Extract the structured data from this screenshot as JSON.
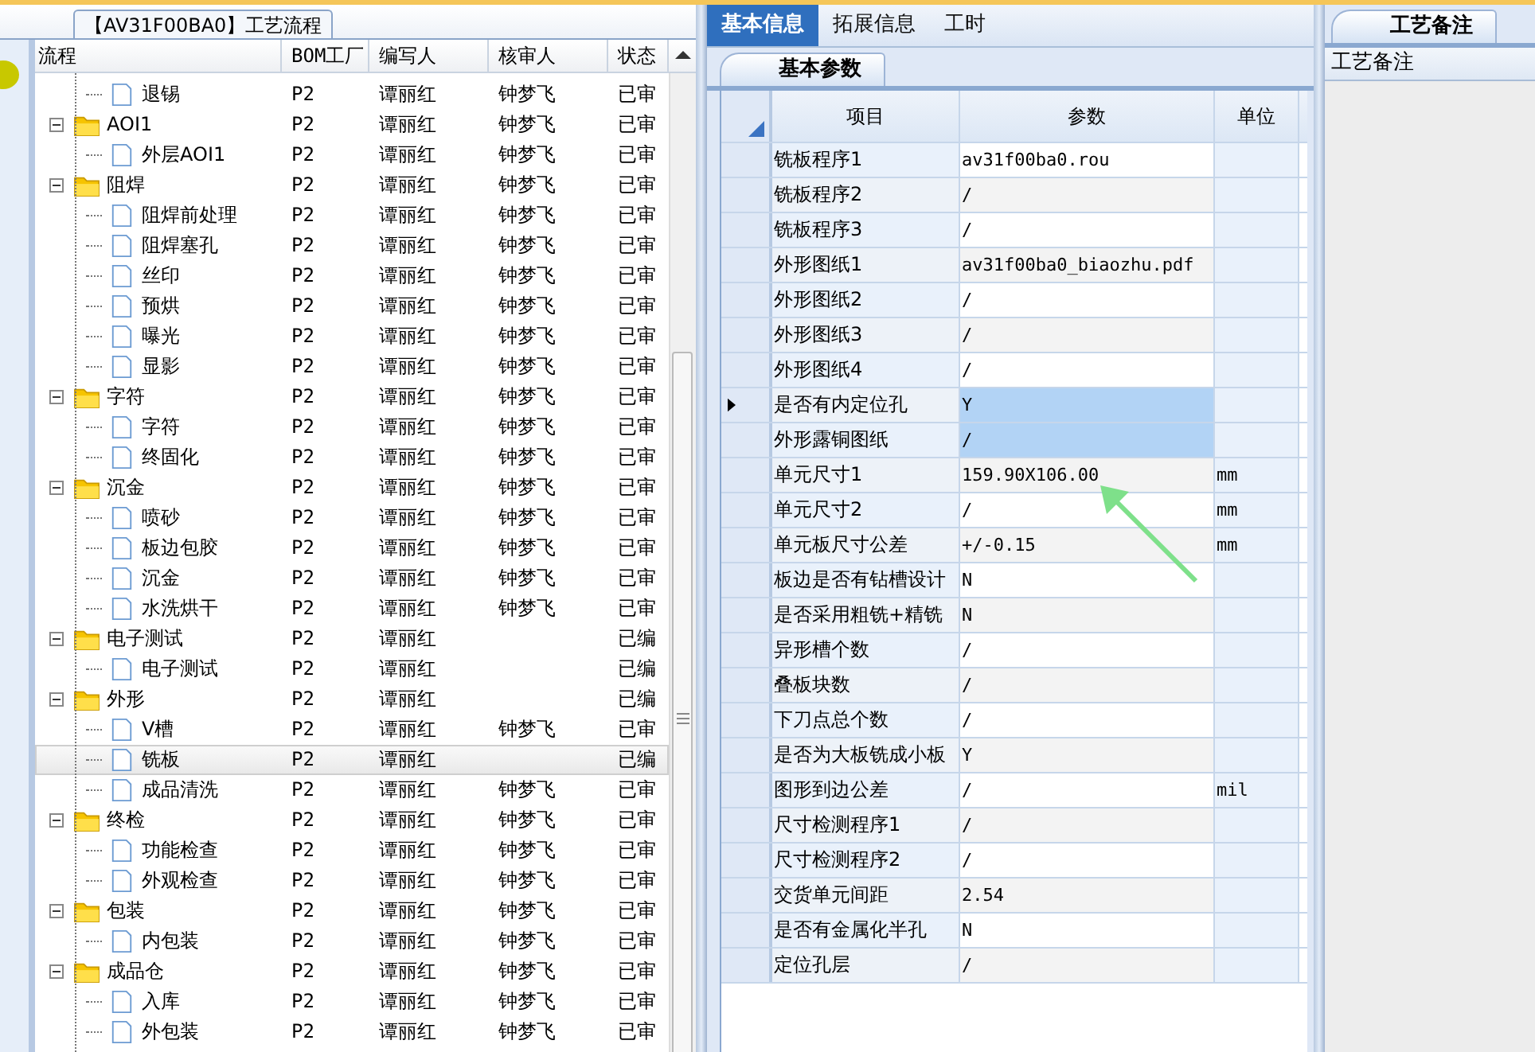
{
  "left_panel": {
    "tab": "【AV31F00BA0】工艺流程",
    "columns": [
      "流程",
      "BOM工厂",
      "编写人",
      "核审人",
      "状态"
    ],
    "tree": [
      {
        "kind": "hidden_folder",
        "children": [
          {
            "kind": "file",
            "label": "退锡",
            "bom_factory": "P2",
            "writer": "谭丽红",
            "reviewer": "钟梦飞",
            "status": "已审",
            "selected": false
          }
        ]
      },
      {
        "kind": "folder",
        "label": "AOI1",
        "bom_factory": "P2",
        "writer": "谭丽红",
        "reviewer": "钟梦飞",
        "status": "已审",
        "selected": false,
        "expanded": true,
        "children": [
          {
            "kind": "file",
            "label": "外层AOI1",
            "bom_factory": "P2",
            "writer": "谭丽红",
            "reviewer": "钟梦飞",
            "status": "已审",
            "selected": false
          }
        ]
      },
      {
        "kind": "folder",
        "label": "阻焊",
        "bom_factory": "P2",
        "writer": "谭丽红",
        "reviewer": "钟梦飞",
        "status": "已审",
        "selected": false,
        "expanded": true,
        "children": [
          {
            "kind": "file",
            "label": "阻焊前处理",
            "bom_factory": "P2",
            "writer": "谭丽红",
            "reviewer": "钟梦飞",
            "status": "已审",
            "selected": false
          },
          {
            "kind": "file",
            "label": "阻焊塞孔",
            "bom_factory": "P2",
            "writer": "谭丽红",
            "reviewer": "钟梦飞",
            "status": "已审",
            "selected": false
          },
          {
            "kind": "file",
            "label": "丝印",
            "bom_factory": "P2",
            "writer": "谭丽红",
            "reviewer": "钟梦飞",
            "status": "已审",
            "selected": false
          },
          {
            "kind": "file",
            "label": "预烘",
            "bom_factory": "P2",
            "writer": "谭丽红",
            "reviewer": "钟梦飞",
            "status": "已审",
            "selected": false
          },
          {
            "kind": "file",
            "label": "曝光",
            "bom_factory": "P2",
            "writer": "谭丽红",
            "reviewer": "钟梦飞",
            "status": "已审",
            "selected": false
          },
          {
            "kind": "file",
            "label": "显影",
            "bom_factory": "P2",
            "writer": "谭丽红",
            "reviewer": "钟梦飞",
            "status": "已审",
            "selected": false
          }
        ]
      },
      {
        "kind": "folder",
        "label": "字符",
        "bom_factory": "P2",
        "writer": "谭丽红",
        "reviewer": "钟梦飞",
        "status": "已审",
        "selected": false,
        "expanded": true,
        "children": [
          {
            "kind": "file",
            "label": "字符",
            "bom_factory": "P2",
            "writer": "谭丽红",
            "reviewer": "钟梦飞",
            "status": "已审",
            "selected": false
          },
          {
            "kind": "file",
            "label": "终固化",
            "bom_factory": "P2",
            "writer": "谭丽红",
            "reviewer": "钟梦飞",
            "status": "已审",
            "selected": false
          }
        ]
      },
      {
        "kind": "folder",
        "label": "沉金",
        "bom_factory": "P2",
        "writer": "谭丽红",
        "reviewer": "钟梦飞",
        "status": "已审",
        "selected": false,
        "expanded": true,
        "children": [
          {
            "kind": "file",
            "label": "喷砂",
            "bom_factory": "P2",
            "writer": "谭丽红",
            "reviewer": "钟梦飞",
            "status": "已审",
            "selected": false
          },
          {
            "kind": "file",
            "label": "板边包胶",
            "bom_factory": "P2",
            "writer": "谭丽红",
            "reviewer": "钟梦飞",
            "status": "已审",
            "selected": false
          },
          {
            "kind": "file",
            "label": "沉金",
            "bom_factory": "P2",
            "writer": "谭丽红",
            "reviewer": "钟梦飞",
            "status": "已审",
            "selected": false
          },
          {
            "kind": "file",
            "label": "水洗烘干",
            "bom_factory": "P2",
            "writer": "谭丽红",
            "reviewer": "钟梦飞",
            "status": "已审",
            "selected": false
          }
        ]
      },
      {
        "kind": "folder",
        "label": "电子测试",
        "bom_factory": "P2",
        "writer": "谭丽红",
        "status": "已编",
        "selected": false,
        "expanded": true,
        "children": [
          {
            "kind": "file",
            "label": "电子测试",
            "bom_factory": "P2",
            "writer": "谭丽红",
            "status": "已编",
            "selected": false
          }
        ]
      },
      {
        "kind": "folder",
        "label": "外形",
        "bom_factory": "P2",
        "writer": "谭丽红",
        "status": "已编",
        "selected": false,
        "expanded": true,
        "children": [
          {
            "kind": "file",
            "label": "V槽",
            "bom_factory": "P2",
            "writer": "谭丽红",
            "reviewer": "钟梦飞",
            "status": "已审",
            "selected": false
          },
          {
            "kind": "file",
            "label": "铣板",
            "bom_factory": "P2",
            "writer": "谭丽红",
            "status": "已编",
            "selected": true
          },
          {
            "kind": "file",
            "label": "成品清洗",
            "bom_factory": "P2",
            "writer": "谭丽红",
            "reviewer": "钟梦飞",
            "status": "已审",
            "selected": false
          }
        ]
      },
      {
        "kind": "folder",
        "label": "终检",
        "bom_factory": "P2",
        "writer": "谭丽红",
        "reviewer": "钟梦飞",
        "status": "已审",
        "selected": false,
        "expanded": true,
        "children": [
          {
            "kind": "file",
            "label": "功能检查",
            "bom_factory": "P2",
            "writer": "谭丽红",
            "reviewer": "钟梦飞",
            "status": "已审",
            "selected": false
          },
          {
            "kind": "file",
            "label": "外观检查",
            "bom_factory": "P2",
            "writer": "谭丽红",
            "reviewer": "钟梦飞",
            "status": "已审",
            "selected": false
          }
        ]
      },
      {
        "kind": "folder",
        "label": "包装",
        "bom_factory": "P2",
        "writer": "谭丽红",
        "reviewer": "钟梦飞",
        "status": "已审",
        "selected": false,
        "expanded": true,
        "children": [
          {
            "kind": "file",
            "label": "内包装",
            "bom_factory": "P2",
            "writer": "谭丽红",
            "reviewer": "钟梦飞",
            "status": "已审",
            "selected": false
          }
        ]
      },
      {
        "kind": "folder",
        "label": "成品仓",
        "bom_factory": "P2",
        "writer": "谭丽红",
        "reviewer": "钟梦飞",
        "status": "已审",
        "selected": false,
        "expanded": true,
        "children": [
          {
            "kind": "file",
            "label": "入库",
            "bom_factory": "P2",
            "writer": "谭丽红",
            "reviewer": "钟梦飞",
            "status": "已审",
            "selected": false
          },
          {
            "kind": "file",
            "label": "外包装",
            "bom_factory": "P2",
            "writer": "谭丽红",
            "reviewer": "钟梦飞",
            "status": "已审",
            "selected": false
          }
        ]
      }
    ]
  },
  "main_tabs": [
    {
      "label": "基本信息",
      "selected": true
    },
    {
      "label": "拓展信息",
      "selected": false
    },
    {
      "label": "工时",
      "selected": false
    }
  ],
  "params_panel": {
    "tab": "基本参数",
    "columns": [
      "项目",
      "参数",
      "单位"
    ],
    "rows": [
      {
        "item": "铣板程序1",
        "value": "av31f00ba0.rou",
        "current": false,
        "selected": false
      },
      {
        "item": "铣板程序2",
        "value": "/",
        "current": false,
        "selected": false
      },
      {
        "item": "铣板程序3",
        "value": "/",
        "current": false,
        "selected": false
      },
      {
        "item": "外形图纸1",
        "value": "av31f00ba0_biaozhu.pdf",
        "current": false,
        "selected": false
      },
      {
        "item": "外形图纸2",
        "value": "/",
        "current": false,
        "selected": false
      },
      {
        "item": "外形图纸3",
        "value": "/",
        "current": false,
        "selected": false
      },
      {
        "item": "外形图纸4",
        "value": "/",
        "current": false,
        "selected": false
      },
      {
        "item": "是否有内定位孔",
        "value": "Y",
        "current": true,
        "selected": true
      },
      {
        "item": "外形露铜图纸",
        "value": "/",
        "current": false,
        "selected": true
      },
      {
        "item": "单元尺寸1",
        "value": "159.90X106.00",
        "unit": "mm",
        "current": false,
        "selected": false
      },
      {
        "item": "单元尺寸2",
        "value": "/",
        "unit": "mm",
        "current": false,
        "selected": false
      },
      {
        "item": "单元板尺寸公差",
        "value": "+/-0.15",
        "unit": "mm",
        "current": false,
        "selected": false
      },
      {
        "item": "板边是否有钻槽设计",
        "value": "N",
        "current": false,
        "selected": false
      },
      {
        "item": "是否采用粗铣+精铣",
        "value": "N",
        "current": false,
        "selected": false
      },
      {
        "item": "异形槽个数",
        "value": "/",
        "current": false,
        "selected": false
      },
      {
        "item": "叠板块数",
        "value": "/",
        "current": false,
        "selected": false
      },
      {
        "item": "下刀点总个数",
        "value": "/",
        "current": false,
        "selected": false
      },
      {
        "item": "是否为大板铣成小板",
        "value": "Y",
        "current": false,
        "selected": false
      },
      {
        "item": "图形到边公差",
        "value": "/",
        "unit": "mil",
        "current": false,
        "selected": false
      },
      {
        "item": "尺寸检测程序1",
        "value": "/",
        "current": false,
        "selected": false
      },
      {
        "item": "尺寸检测程序2",
        "value": "/",
        "current": false,
        "selected": false
      },
      {
        "item": "交货单元间距",
        "value": "2.54",
        "current": false,
        "selected": false
      },
      {
        "item": "是否有金属化半孔",
        "value": "N",
        "current": false,
        "selected": false
      },
      {
        "item": "定位孔层",
        "value": "/",
        "current": false,
        "selected": false
      }
    ]
  },
  "notes_panel": {
    "tab": "工艺备注",
    "header": "工艺备注"
  }
}
